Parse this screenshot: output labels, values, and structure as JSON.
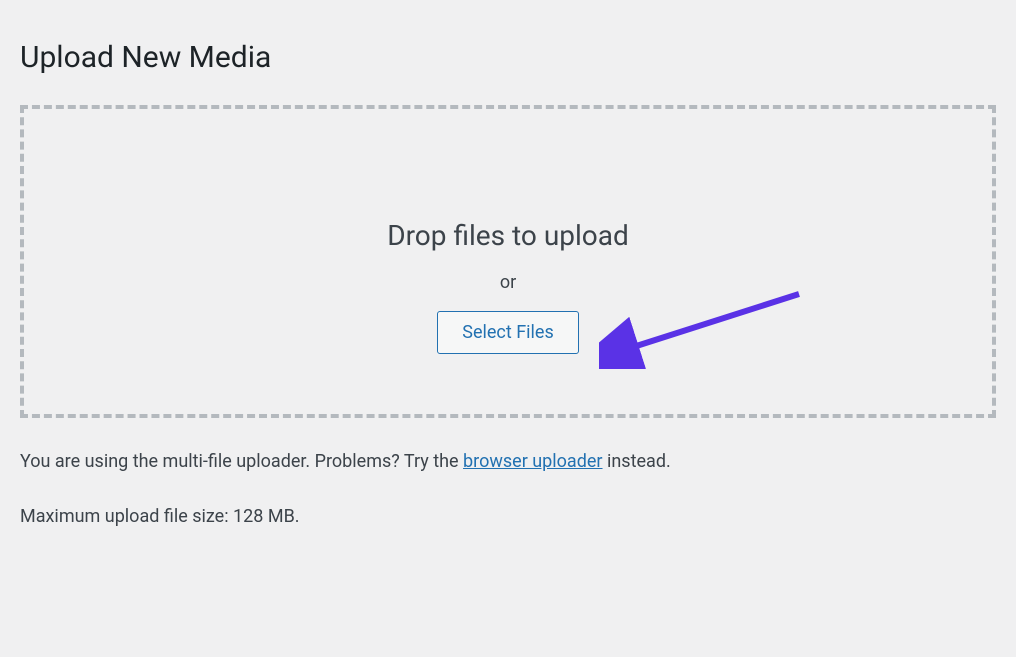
{
  "page": {
    "title": "Upload New Media"
  },
  "dropzone": {
    "heading": "Drop files to upload",
    "or": "or",
    "button_label": "Select Files"
  },
  "helper": {
    "prefix": "You are using the multi-file uploader. Problems? Try the ",
    "link_text": "browser uploader",
    "suffix": " instead."
  },
  "limit": {
    "text": "Maximum upload file size: 128 MB."
  },
  "annotation": {
    "arrow_color": "#5a32e6"
  }
}
